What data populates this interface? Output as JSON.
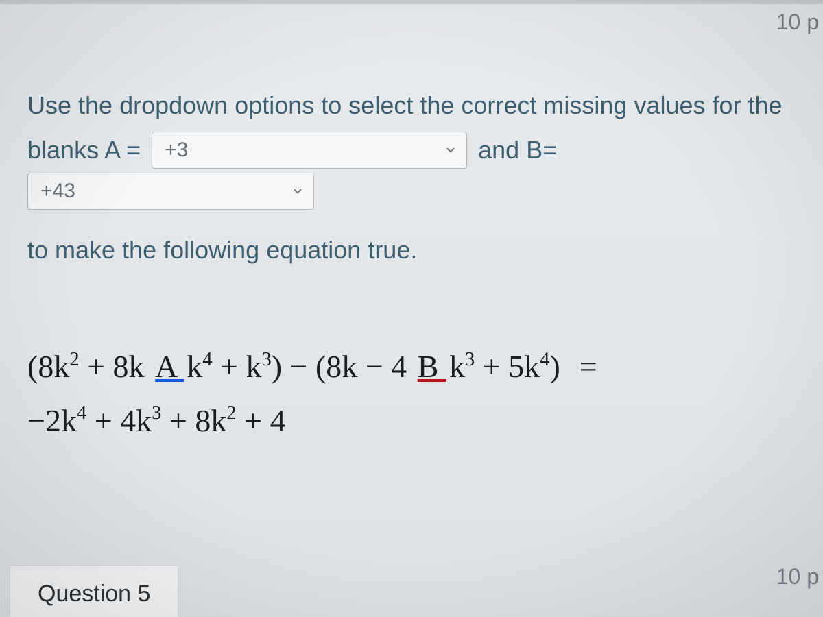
{
  "points_top": "10 p",
  "points_bottom": "10 p",
  "instruction_line1": "Use the dropdown options to select the correct missing values for the",
  "blanks_prefix": "blanks A = ",
  "dropdown_a": {
    "value": "+3"
  },
  "and_b_text": " and B= ",
  "dropdown_b": {
    "value": "+43"
  },
  "followup_text": "to make the following equation true.",
  "equation": {
    "line1_left_open": "(8",
    "k": "k",
    "sq": "2",
    "plus8k": " + 8k ",
    "A_label": " A ",
    "k4": "4",
    "plus_k3_close": " + ",
    "k3": "3",
    "close_minus_open": ") − (8",
    "minus4": " − 4 ",
    "B_label": " B ",
    "plus5k4_close": " + 5",
    "close_paren": ")",
    "equals": "=",
    "line2_m2": "−2",
    "plus4": " + 4",
    "plus8": " + 8",
    "plus4const": " + 4"
  },
  "next_question_label": "Question 5"
}
